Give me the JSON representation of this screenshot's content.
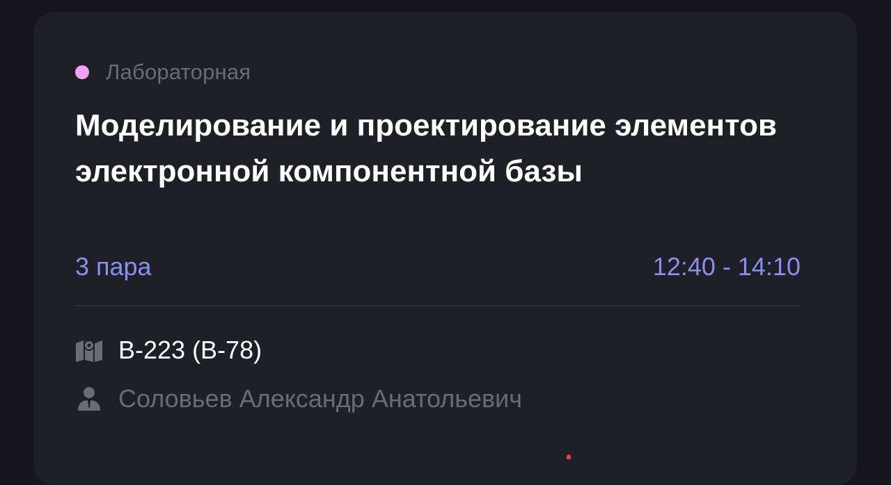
{
  "lesson": {
    "type_label": "Лабораторная",
    "type_color": "#f0a3f5",
    "title": "Моделирование и проектирование элементов электронной компонентной базы",
    "pair": "3 пара",
    "time": "12:40 - 14:10",
    "room": "В-223 (В-78)",
    "teacher": "Соловьев Александр Анатольевич"
  },
  "icons": {
    "room": "map-icon",
    "teacher": "person-icon"
  },
  "colors": {
    "background": "#16161c",
    "card": "#1f1f27",
    "accent": "#8a8ff0",
    "muted": "#6b6b78",
    "text": "#ffffff"
  }
}
